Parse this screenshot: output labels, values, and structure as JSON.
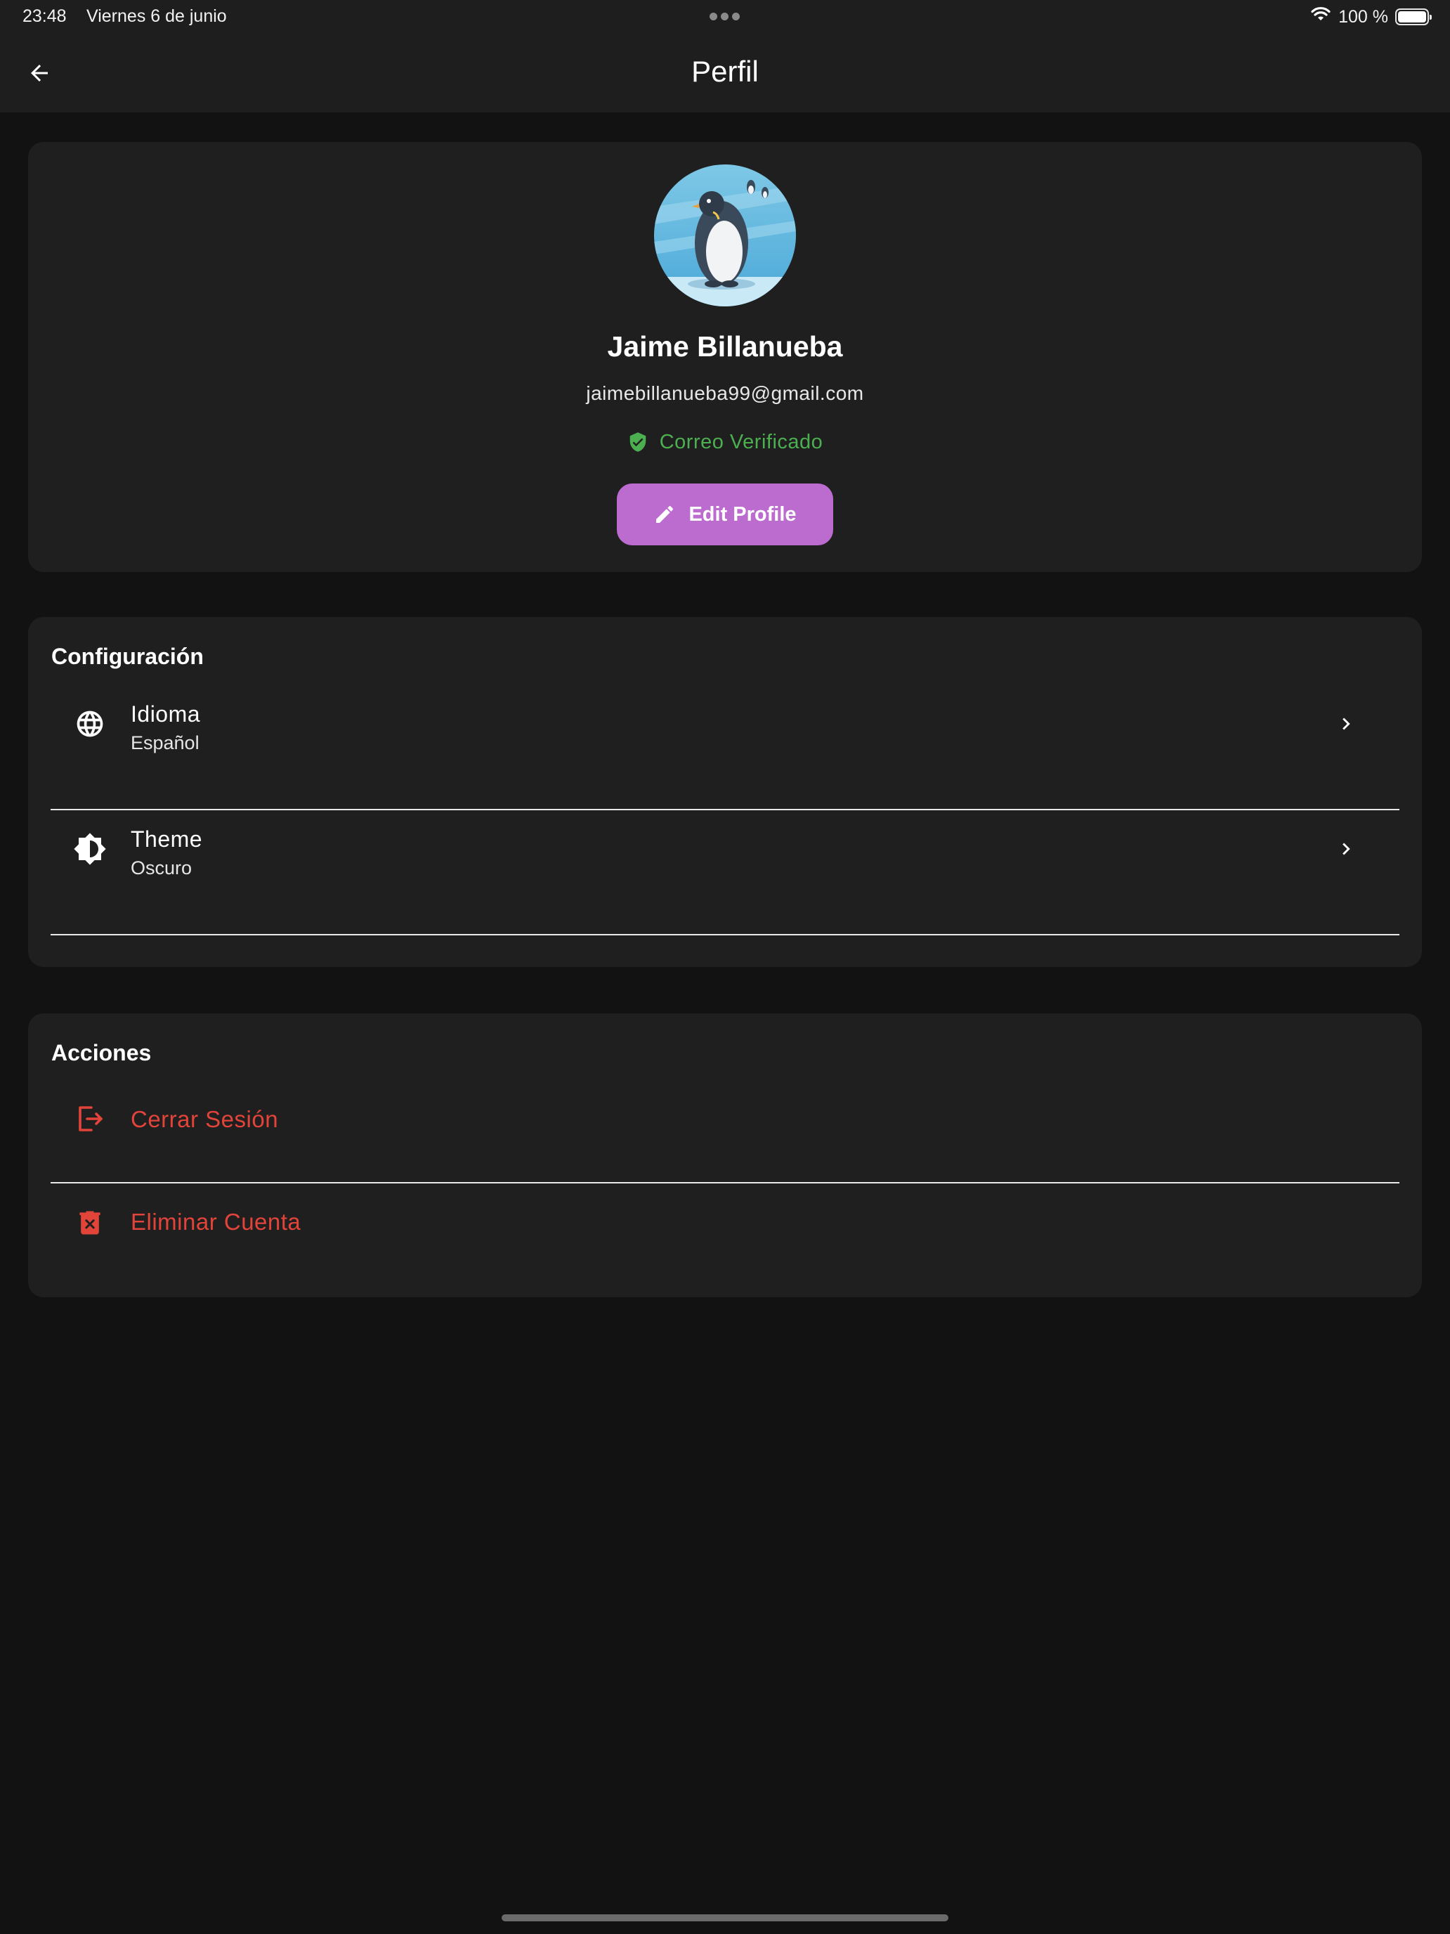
{
  "status_bar": {
    "time": "23:48",
    "date": "Viernes 6 de junio",
    "battery_text": "100 %",
    "battery_level": 1.0,
    "icons": [
      "wifi-icon",
      "battery-icon"
    ]
  },
  "appbar": {
    "title": "Perfil",
    "back_icon": "arrow-left-icon"
  },
  "profile": {
    "name": "Jaime Billanueba",
    "email": "jaimebillanueba99@gmail.com",
    "verified_label": "Correo Verificado",
    "verified_color": "#4caf50",
    "edit_button_label": "Edit Profile",
    "edit_button_color": "#bc6ccf",
    "avatar": "penguin-avatar"
  },
  "settings": {
    "title": "Configuración",
    "items": [
      {
        "icon": "globe-icon",
        "label": "Idioma",
        "value": "Español"
      },
      {
        "icon": "brightness-icon",
        "label": "Theme",
        "value": "Oscuro"
      }
    ]
  },
  "actions": {
    "title": "Acciones",
    "danger_color": "#e2443a",
    "items": [
      {
        "icon": "logout-icon",
        "label": "Cerrar Sesión"
      },
      {
        "icon": "trash-icon",
        "label": "Eliminar Cuenta"
      }
    ]
  },
  "colors": {
    "background": "#121212",
    "card": "#1f1f20",
    "appbar": "#1e1e1e"
  }
}
